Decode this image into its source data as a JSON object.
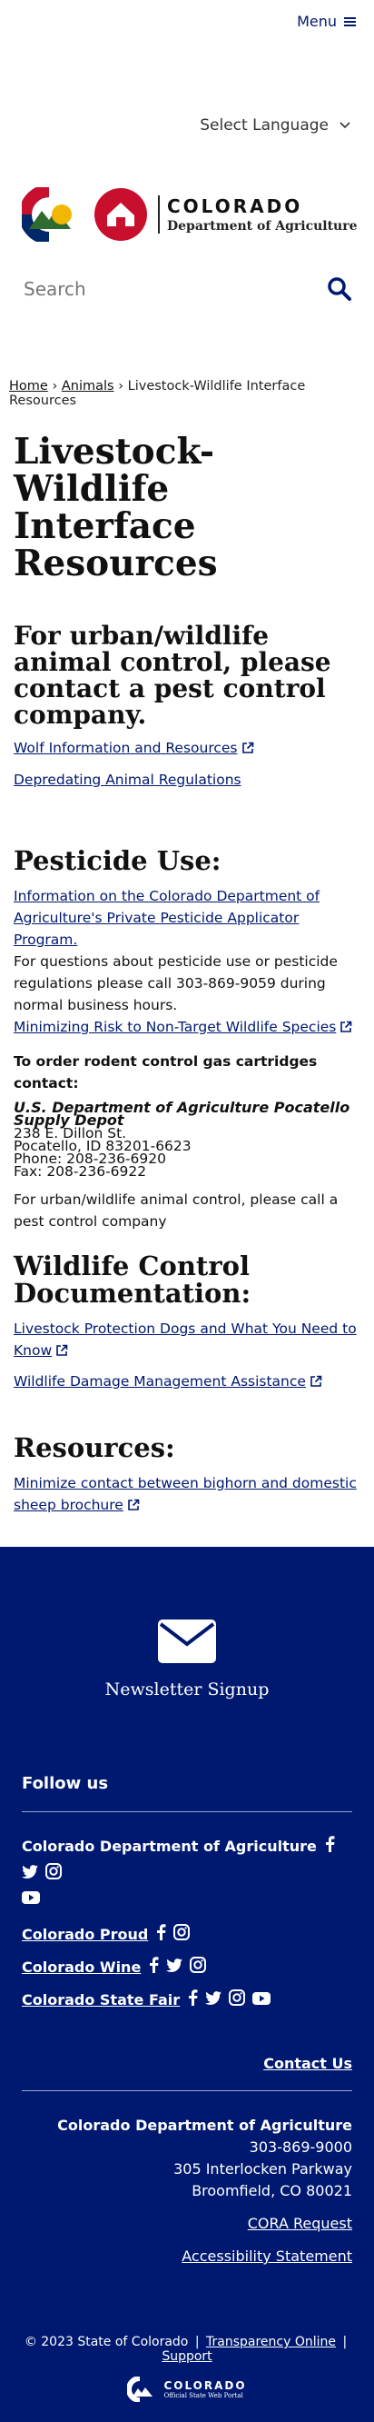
{
  "header": {
    "menu_label": "Menu",
    "language_label": "Select Language",
    "logo_title": "COLORADO",
    "logo_subtitle": "Department of Agriculture",
    "logo_badge": "CDA",
    "search_placeholder": "Search"
  },
  "breadcrumb": {
    "home": "Home",
    "sep1": "›",
    "animals": "Animals",
    "sep2": "›",
    "current": "Livestock-Wildlife Interface Resources"
  },
  "main": {
    "title": "Livestock-Wildlife Interface Resources",
    "intro_heading": "For urban/wildlife animal control, please contact a pest control company.",
    "wolf_link": "Wolf Information and Resources",
    "depredating_link": "Depredating Animal Regulations",
    "pesticide_heading": "Pesticide Use:",
    "pesticide_link": "Information on the Colorado Department of Agriculture's Private Pesticide Applicator Program.",
    "pesticide_text": "For questions about pesticide use or pesticide regulations please call 303-869-9059 during normal business hours.",
    "risk_link": "Minimizing Risk to Non-Target Wildlife Species",
    "rodent_heading": "To order rodent control gas cartridges contact:",
    "supply_name": "U.S. Department of Agriculture Pocatello Supply Depot",
    "supply_street": "238 E. Dillon St.",
    "supply_city": "Pocatello, ID 83201-6623",
    "supply_phone": "Phone: 208-236-6920",
    "supply_fax": "Fax: 208-236-6922",
    "urban_text": "For urban/wildlife animal control, please call a pest control company",
    "wildlife_heading": "Wildlife Control Documentation:",
    "dogs_link": "Livestock Protection Dogs and What You Need to Know",
    "damage_link": "Wildlife Damage Management Assistance",
    "resources_heading": "Resources:",
    "bighorn_link": "Minimize contact between bighorn and domestic sheep brochure"
  },
  "footer": {
    "newsletter_label": "Newsletter Signup",
    "follow_heading": "Follow us",
    "social": [
      {
        "label": "Colorado Department of Agriculture"
      },
      {
        "label": "Colorado Proud"
      },
      {
        "label": "Colorado Wine"
      },
      {
        "label": "Colorado State Fair"
      }
    ],
    "contact_link": "Contact Us",
    "org_name": "Colorado Department of Agriculture",
    "phone": "303-869-9000",
    "street": "305 Interlocken Parkway",
    "city": "Broomfield, CO 80021",
    "cora_link": "CORA Request",
    "accessibility_link": "Accessibility Statement",
    "copyright": "© 2023 State of Colorado",
    "sep1": "|",
    "transparency_link": "Transparency Online",
    "sep2": "|",
    "support_link": "Support",
    "portal_title": "COLORADO",
    "portal_subtitle": "Official State Web Portal"
  },
  "colors": {
    "brand_navy": "#001970",
    "co_red": "#c8102e",
    "co_gold": "#f2b705",
    "co_blue": "#002868"
  }
}
